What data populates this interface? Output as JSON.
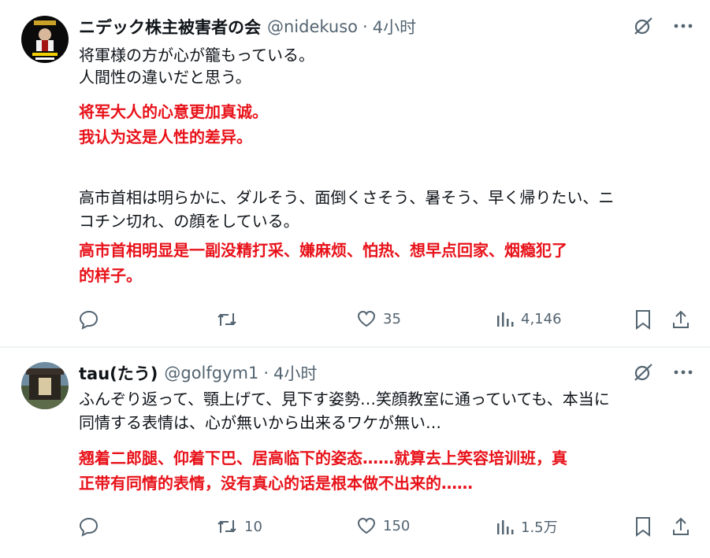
{
  "tweets": [
    {
      "author_name": "ニデック株主被害者の会",
      "handle": "@nidekuso",
      "separator": "·",
      "time": "4小时",
      "ja_lines": [
        "将軍様の方が心が籠もっている。",
        "人間性の違いだと思う。"
      ],
      "zh_lines": [
        "将军大人的心意更加真诚。",
        "我认为这是人性的差异。"
      ],
      "ja2_lines": [
        "高市首相は明らかに、ダルそう、面倒くさそう、暑そう、早く帰りたい、ニ",
        "コチン切れ、の顔をしている。"
      ],
      "zh2_lines": [
        "高市首相明显是一副没精打采、嫌麻烦、怕热、想早点回家、烟瘾犯了",
        "的样子。"
      ],
      "reply_count": "",
      "repost_count": "",
      "like_count": "35",
      "view_count": "4,146"
    },
    {
      "author_name": "tau(たう)",
      "handle": "@golfgym1",
      "separator": "·",
      "time": "4小时",
      "ja_lines": [
        "ふんぞり返って、顎上げて、見下す姿勢…笑顔教室に通っていても、本当に",
        "同情する表情は、心が無いから出来るワケが無い…"
      ],
      "zh_lines": [
        "翘着二郎腿、仰着下巴、居高临下的姿态……就算去上笑容培训班，真",
        "正带有同情的表情，没有真心的话是根本做不出来的……"
      ],
      "reply_count": "",
      "repost_count": "10",
      "like_count": "150",
      "view_count": "1.5万"
    }
  ],
  "colors": {
    "red_text": "#e8121a",
    "muted": "#536471",
    "text": "#0f1419"
  }
}
